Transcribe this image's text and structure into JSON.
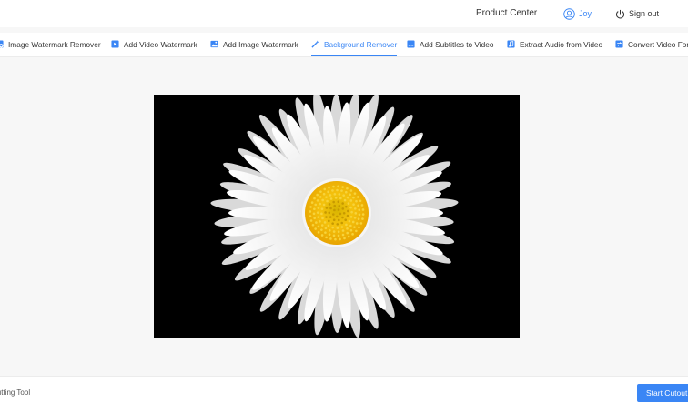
{
  "header": {
    "product_center": "Product Center",
    "user_name": "Joy",
    "sign_out": "Sign out",
    "accent_color": "#3a86f5"
  },
  "tabs": [
    {
      "label": "Image Watermark Remover",
      "icon": "image-watermark-icon",
      "active": false
    },
    {
      "label": "Add Video Watermark",
      "icon": "video-watermark-icon",
      "active": false
    },
    {
      "label": "Add Image Watermark",
      "icon": "image-icon",
      "active": false
    },
    {
      "label": "Background Remover",
      "icon": "magic-wand-icon",
      "active": true
    },
    {
      "label": "Add Subtitles to Video",
      "icon": "subtitles-icon",
      "active": false
    },
    {
      "label": "Extract Audio from Video",
      "icon": "audio-extract-icon",
      "active": false
    },
    {
      "label": "Convert Video Format",
      "icon": "convert-icon",
      "active": false
    }
  ],
  "canvas": {
    "image": "daisy-on-black-photo"
  },
  "footer": {
    "tool_label": "Cutting Tool",
    "start_button": "Start Cutout"
  }
}
